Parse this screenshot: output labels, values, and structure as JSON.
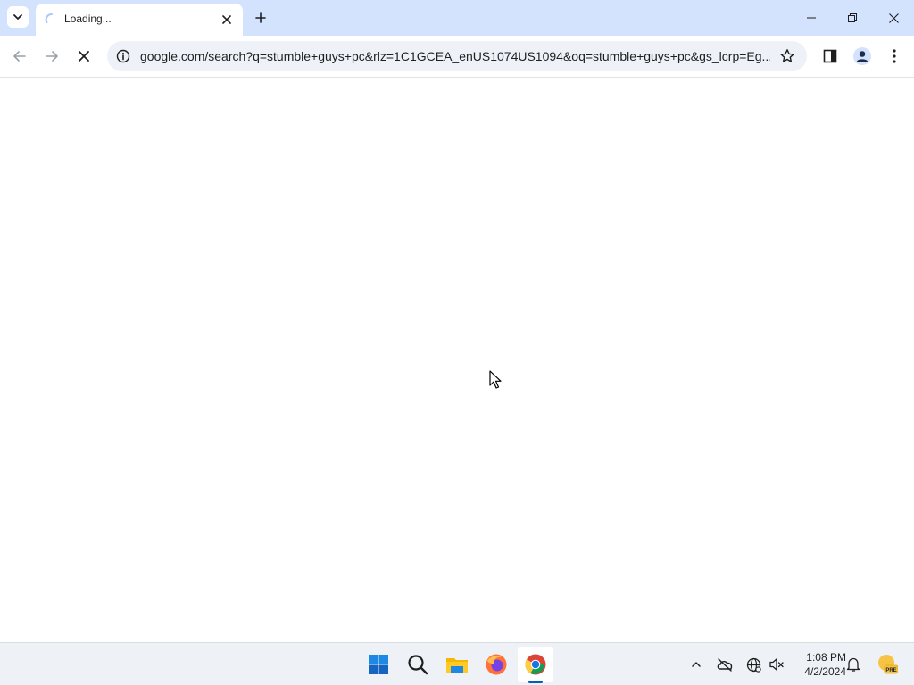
{
  "browser": {
    "tab": {
      "title": "Loading..."
    },
    "address_bar": {
      "url": "google.com/search?q=stumble+guys+pc&rlz=1C1GCEA_enUS1074US1094&oq=stumble+guys+pc&gs_lcrp=Eg..."
    }
  },
  "icons": {
    "tab_search": "chevron-down-icon",
    "tab_loading": "spinner-icon",
    "tab_close": "close-icon",
    "new_tab": "plus-icon",
    "minimize": "minimize-icon",
    "maximize": "restore-icon",
    "close_window": "close-icon",
    "back": "arrow-left-icon",
    "forward": "arrow-right-icon",
    "stop": "stop-icon",
    "site_info": "info-icon",
    "bookmark": "star-icon",
    "side_panel": "side-panel-icon",
    "profile": "person-icon",
    "menu": "kebab-menu-icon"
  },
  "taskbar": {
    "apps": [
      "start-button",
      "search",
      "file-explorer",
      "firefox",
      "chrome"
    ],
    "active_app": "chrome",
    "clock": {
      "time": "1:08 PM",
      "date": "4/2/2024"
    },
    "weather_badge": "PRE"
  },
  "colors": {
    "tab_strip": "#d3e3fd",
    "omnibox": "#eef2f8",
    "taskbar": "#eef1f6",
    "accent": "#005fb8"
  }
}
